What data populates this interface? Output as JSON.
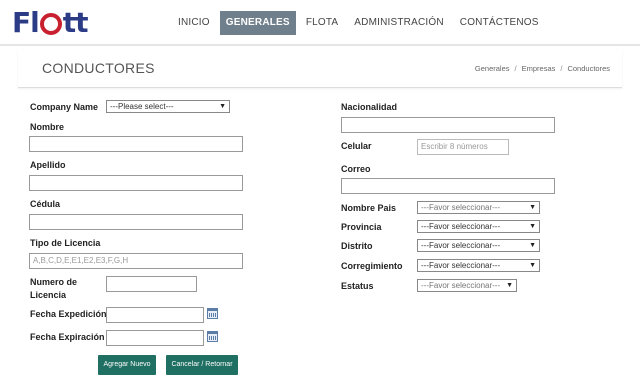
{
  "brand": {
    "logo_prefix": "Fl",
    "logo_suffix": "tt"
  },
  "nav": {
    "items": [
      {
        "label": "INICIO",
        "active": false
      },
      {
        "label": "GENERALES",
        "active": true
      },
      {
        "label": "FLOTA",
        "active": false
      },
      {
        "label": "ADMINISTRACIÓN",
        "active": false
      },
      {
        "label": "CONTÁCTENOS",
        "active": false
      }
    ]
  },
  "page": {
    "title": "CONDUCTORES",
    "breadcrumb": [
      "Generales",
      "Empresas",
      "Conductores"
    ],
    "breadcrumb_sep": "/"
  },
  "form": {
    "company_label": "Company Name",
    "company_value": "---Please select---",
    "nombre_label": "Nombre",
    "apellido_label": "Apellido",
    "cedula_label": "Cédula",
    "tipo_licencia_label": "Tipo de Licencia",
    "tipo_licencia_placeholder": "A,B,C,D,E,E1,E2,E3,F,G,H",
    "numero_licencia_label_1": "Numero de",
    "numero_licencia_label_2": "Licencia",
    "fecha_expedicion_label": "Fecha Expedición",
    "fecha_expiracion_label": "Fecha Expiración",
    "nacionalidad_label": "Nacionalidad",
    "celular_label": "Celular",
    "celular_placeholder": "Escribir 8 números",
    "correo_label": "Correo",
    "nombre_pais_label": "Nombre Pais",
    "nombre_pais_value": "---Favor seleccionar---",
    "provincia_label": "Provincia",
    "provincia_value": "---Favor seleccionar---",
    "distrito_label": "Distrito",
    "distrito_value": "---Favor seleccionar---",
    "corregimiento_label": "Corregimiento",
    "corregimiento_value": "---Favor seleccionar---",
    "estatus_label": "Estatus",
    "estatus_value": "---Favor seleccionar---"
  },
  "buttons": {
    "add_label": "Agregar Nuevo",
    "cancel_label": "Cancelar / Retornar"
  },
  "colors": {
    "brand_blue": "#2b3b85",
    "brand_red": "#c8202f",
    "nav_active_bg": "#6f7f8b",
    "button_bg": "#1f6f62"
  }
}
